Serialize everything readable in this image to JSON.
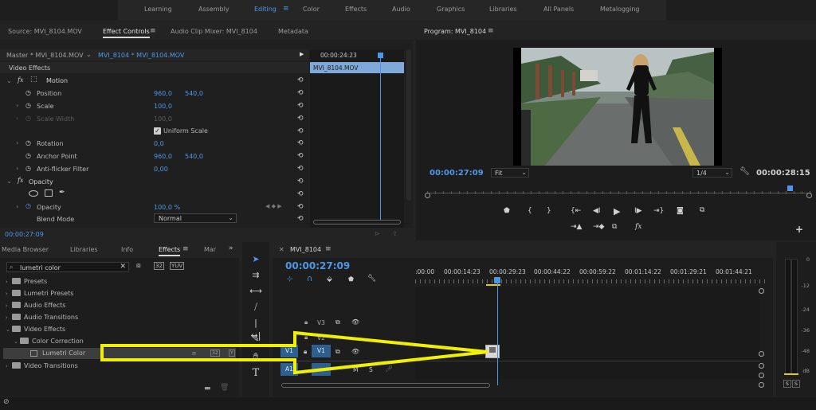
{
  "workspace": {
    "tabs": [
      "Learning",
      "Assembly",
      "Editing",
      "Color",
      "Effects",
      "Audio",
      "Graphics",
      "Libraries",
      "All Panels",
      "Metalogging"
    ],
    "active": "Editing"
  },
  "source_panel": {
    "tabs": [
      "Source: MVI_8104.MOV",
      "Effect Controls",
      "Audio Clip Mixer: MVI_8104",
      "Metadata"
    ],
    "active": "Effect Controls"
  },
  "effect_controls": {
    "master": "Master * MVI_8104.MOV",
    "sequence_clip": "MVI_8104 * MVI_8104.MOV",
    "timecode_top": "00:00:24:23",
    "clip_label": "MVI_8104.MOV",
    "section": "Video Effects",
    "motion": "Motion",
    "props": [
      {
        "name": "Position",
        "v1": "960,0",
        "v2": "540,0"
      },
      {
        "name": "Scale",
        "v1": "100,0",
        "v2": ""
      },
      {
        "name": "Scale Width",
        "v1": "100,0",
        "v2": ""
      },
      {
        "name": "Rotation",
        "v1": "0,0",
        "v2": ""
      },
      {
        "name": "Anchor Point",
        "v1": "960,0",
        "v2": "540,0"
      },
      {
        "name": "Anti-flicker Filter",
        "v1": "0,00",
        "v2": ""
      }
    ],
    "uniform_scale": "Uniform Scale",
    "opacity_section": "Opacity",
    "opacity_label": "Opacity",
    "opacity_value": "100,0 %",
    "blend_label": "Blend Mode",
    "blend_value": "Normal",
    "timecode": "00:00:27:09"
  },
  "program": {
    "title": "Program: MVI_8104",
    "timecode": "00:00:27:09",
    "fit": "Fit",
    "resolution": "1/4",
    "duration": "00:00:28:15"
  },
  "project": {
    "tabs": [
      "Media Browser",
      "Libraries",
      "Info",
      "Effects",
      "Mar"
    ],
    "active": "Effects",
    "search": "lumetri color",
    "items": [
      {
        "label": "Presets",
        "indent": 0
      },
      {
        "label": "Lumetri Presets",
        "indent": 0
      },
      {
        "label": "Audio Effects",
        "indent": 0
      },
      {
        "label": "Audio Transitions",
        "indent": 0
      },
      {
        "label": "Video Effects",
        "indent": 0
      },
      {
        "label": "Color Correction",
        "indent": 1
      },
      {
        "label": "Lumetri Color",
        "indent": 2
      },
      {
        "label": "Video Transitions",
        "indent": 0
      }
    ]
  },
  "timeline": {
    "title": "MVI_8104",
    "timecode": "00:00:27:09",
    "ruler": [
      ":00:00",
      "00:00:14:23",
      "00:00:29:23",
      "00:00:44:22",
      "00:00:59:22",
      "00:01:14:22",
      "00:01:29:21",
      "00:01:44:21"
    ],
    "tracks": {
      "v3": "V3",
      "v2": "V2",
      "v1": "V1",
      "a1": "A1",
      "v1_src": "V1",
      "m": "M",
      "s": "S"
    }
  },
  "meters": {
    "labels": [
      "0",
      "-12",
      "-24",
      "-36",
      "-48",
      "dB"
    ],
    "s_labels": [
      "S",
      "S"
    ]
  },
  "colors": {
    "accent": "#4f97e6",
    "arrow": "#f0f000"
  }
}
